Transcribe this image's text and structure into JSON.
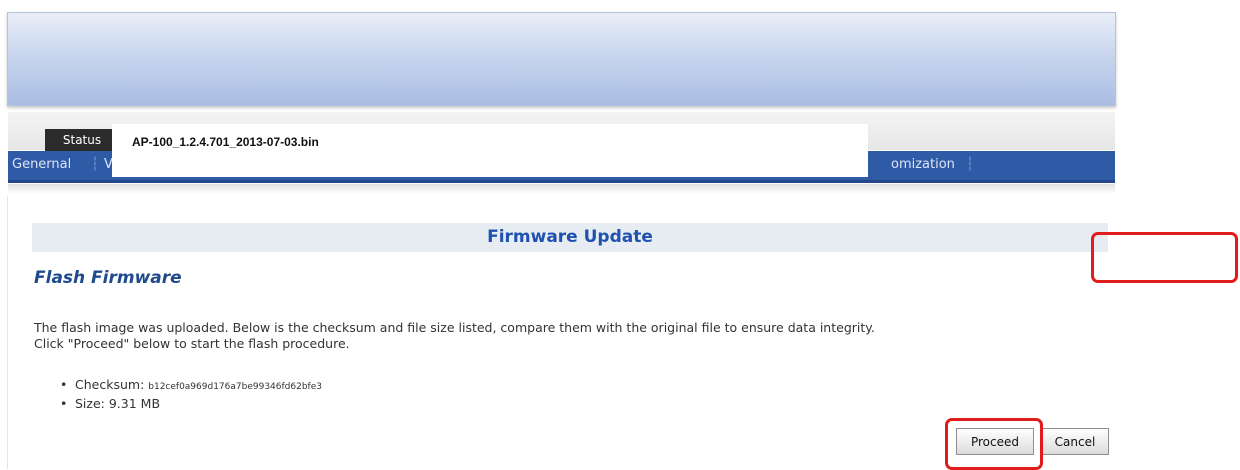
{
  "header": {
    "status_tab": "Status"
  },
  "subnav": {
    "items": [
      {
        "label": "Genernal"
      },
      {
        "label": "V"
      },
      {
        "label": "omization"
      }
    ]
  },
  "overlay": {
    "filename": "AP-100_1.2.4.701_2013-07-03.bin"
  },
  "section": {
    "title": "Firmware Update",
    "subtitle": "Flash Firmware",
    "description": [
      "The flash image was uploaded. Below is the checksum and file size listed, compare them with the original file to ensure data integrity.",
      "Click \"Proceed\" below to start the flash procedure."
    ],
    "checksum_label": "Checksum: ",
    "checksum_value": "b12cef0a969d176a7be99346fd62bfe3",
    "size_label": "Size: ",
    "size_value": "9.31 MB"
  },
  "buttons": {
    "proceed": "Proceed",
    "cancel": "Cancel"
  },
  "colors": {
    "nav_blue": "#2f5aa6",
    "title_blue": "#1f52ae",
    "highlight_red": "#e01c1c"
  }
}
